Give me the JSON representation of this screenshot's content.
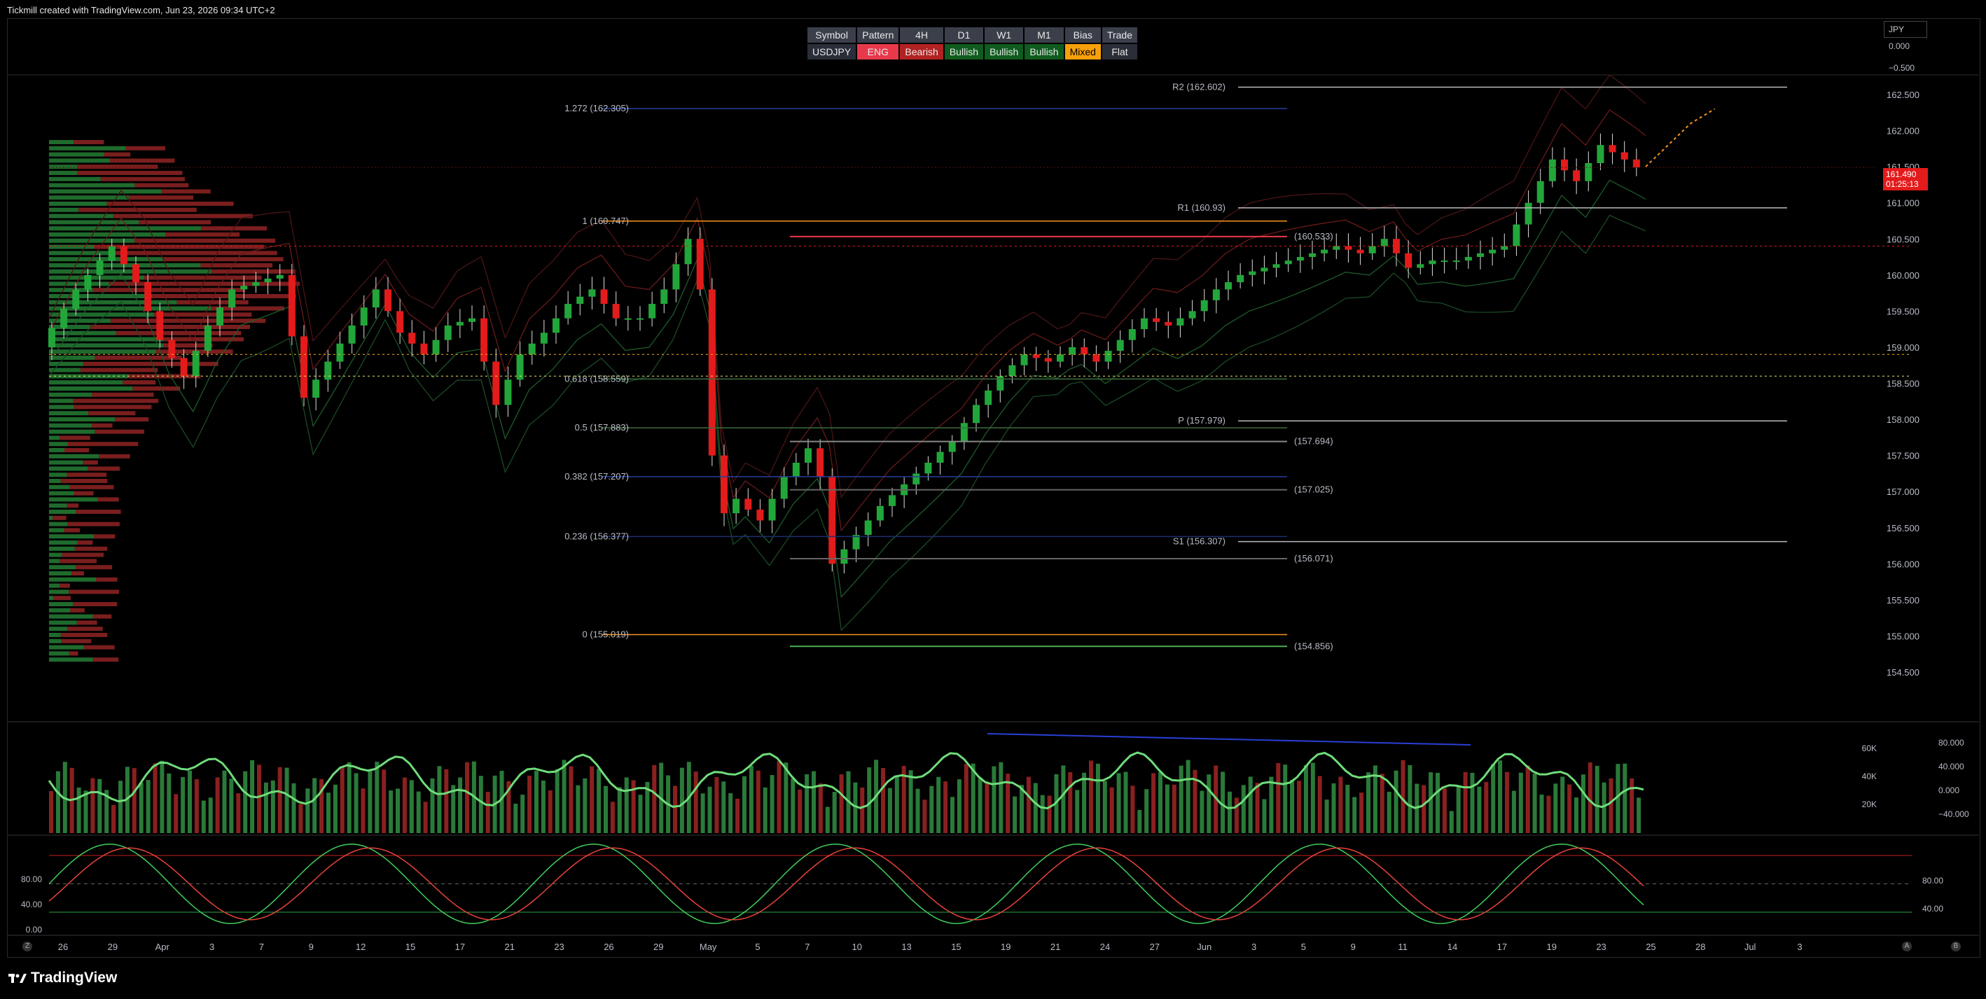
{
  "header": {
    "credit": "Tickmill created with TradingView.com, Jun 23, 2026 09:34 UTC+2"
  },
  "status_table": {
    "headers": [
      "Symbol",
      "Pattern",
      "4H",
      "D1",
      "W1",
      "M1",
      "Bias",
      "Trade"
    ],
    "values": [
      "USDJPY",
      "ENG",
      "Bearish",
      "Bullish",
      "Bullish",
      "Bullish",
      "Mixed",
      "Flat"
    ]
  },
  "currency_box": "JPY",
  "oscillator_top_labels": [
    "0.000",
    "−0.500"
  ],
  "price_badge": {
    "price": "161.490",
    "countdown": "01:25:13"
  },
  "price_axis": [
    "162.500",
    "162.000",
    "161.500",
    "161.000",
    "160.500",
    "160.000",
    "159.500",
    "159.000",
    "158.500",
    "158.000",
    "157.500",
    "157.000",
    "156.500",
    "156.000",
    "155.500",
    "155.000",
    "154.500"
  ],
  "levels": {
    "fib": [
      {
        "label": "1.272 (162.305)",
        "value": 162.305,
        "color": "#2a3f9e"
      },
      {
        "label": "1 (160.747)",
        "value": 160.747,
        "color": "#f7931e"
      },
      {
        "label": "0.618 (158.559)",
        "value": 158.559,
        "color": "#3d6e3d"
      },
      {
        "label": "0.5 (157.883)",
        "value": 157.883,
        "color": "#3d6e3d"
      },
      {
        "label": "0.382 (157.207)",
        "value": 157.207,
        "color": "#2a3f9e"
      },
      {
        "label": "0.236 (156.377)",
        "value": 156.377,
        "color": "#1e2e6e"
      },
      {
        "label": "0 (155.019)",
        "value": 155.019,
        "color": "#f7931e"
      }
    ],
    "pivots": [
      {
        "label": "R2 (162.602)",
        "value": 162.602
      },
      {
        "label": "R1 (160.93)",
        "value": 160.93
      },
      {
        "label": "P (157.979)",
        "value": 157.979
      },
      {
        "label": "S1 (156.307)",
        "value": 156.307
      }
    ],
    "zones": [
      {
        "label": "(160.533)",
        "value": 160.533,
        "color": "#e8394a"
      },
      {
        "label": "(157.694)",
        "value": 157.694,
        "color": "#888888"
      },
      {
        "label": "(157.025)",
        "value": 157.025,
        "color": "#666666"
      },
      {
        "label": "(156.071)",
        "value": 156.071,
        "color": "#666666"
      },
      {
        "label": "(154.856)",
        "value": 154.856,
        "color": "#4caf50"
      }
    ]
  },
  "volume_axis_left": [
    "60K",
    "40K",
    "20K"
  ],
  "volume_axis_right": [
    "80.000",
    "40.000",
    "0.000",
    "−40.000"
  ],
  "stoch_axis_left": [
    "80.00",
    "40.00",
    "0.00"
  ],
  "stoch_axis_right": [
    "80.00",
    "40.00"
  ],
  "time_axis": [
    "26",
    "29",
    "Apr",
    "3",
    "7",
    "9",
    "12",
    "15",
    "17",
    "21",
    "23",
    "26",
    "29",
    "May",
    "5",
    "7",
    "10",
    "13",
    "15",
    "19",
    "21",
    "24",
    "27",
    "Jun",
    "3",
    "5",
    "9",
    "11",
    "14",
    "17",
    "19",
    "23",
    "25",
    "28",
    "Jul",
    "3"
  ],
  "corner_buttons": [
    "Z",
    "A",
    "B"
  ],
  "footer": {
    "brand": "TradingView"
  },
  "chart_data": {
    "type": "candlestick",
    "symbol": "USDJPY",
    "ylim": [
      154.3,
      162.7
    ],
    "last_price": 161.49,
    "close_path": [
      [
        0,
        159.0
      ],
      [
        3,
        159.8
      ],
      [
        6,
        160.4
      ],
      [
        8,
        159.9
      ],
      [
        10,
        159.1
      ],
      [
        12,
        158.6
      ],
      [
        14,
        159.3
      ],
      [
        16,
        159.8
      ],
      [
        18,
        159.9
      ],
      [
        20,
        160.0
      ],
      [
        22,
        158.3
      ],
      [
        24,
        158.8
      ],
      [
        26,
        159.3
      ],
      [
        28,
        159.8
      ],
      [
        30,
        159.2
      ],
      [
        32,
        158.9
      ],
      [
        34,
        159.3
      ],
      [
        36,
        159.4
      ],
      [
        38,
        158.2
      ],
      [
        40,
        158.9
      ],
      [
        42,
        159.2
      ],
      [
        44,
        159.6
      ],
      [
        46,
        159.8
      ],
      [
        48,
        159.4
      ],
      [
        50,
        159.4
      ],
      [
        52,
        159.8
      ],
      [
        54,
        160.5
      ],
      [
        55,
        159.8
      ],
      [
        56,
        157.5
      ],
      [
        57,
        156.7
      ],
      [
        58,
        156.9
      ],
      [
        60,
        156.6
      ],
      [
        62,
        157.2
      ],
      [
        64,
        157.6
      ],
      [
        65,
        157.2
      ],
      [
        66,
        156.0
      ],
      [
        68,
        156.4
      ],
      [
        70,
        156.8
      ],
      [
        72,
        157.1
      ],
      [
        74,
        157.4
      ],
      [
        76,
        157.7
      ],
      [
        78,
        158.2
      ],
      [
        80,
        158.6
      ],
      [
        82,
        158.9
      ],
      [
        84,
        158.8
      ],
      [
        86,
        159.0
      ],
      [
        88,
        158.8
      ],
      [
        90,
        159.1
      ],
      [
        92,
        159.4
      ],
      [
        94,
        159.3
      ],
      [
        96,
        159.5
      ],
      [
        98,
        159.8
      ],
      [
        100,
        160.0
      ],
      [
        102,
        160.1
      ],
      [
        104,
        160.2
      ],
      [
        106,
        160.3
      ],
      [
        108,
        160.4
      ],
      [
        110,
        160.3
      ],
      [
        112,
        160.5
      ],
      [
        114,
        160.1
      ],
      [
        116,
        160.2
      ],
      [
        118,
        160.2
      ],
      [
        120,
        160.3
      ],
      [
        122,
        160.4
      ],
      [
        124,
        161.0
      ],
      [
        126,
        161.6
      ],
      [
        128,
        161.3
      ],
      [
        130,
        161.8
      ],
      [
        132,
        161.6
      ],
      [
        133,
        161.49
      ]
    ],
    "projection": [
      [
        133,
        161.5
      ],
      [
        135,
        162.1
      ],
      [
        137,
        162.3
      ]
    ],
    "volume_cvd": {
      "ylim_left": [
        0,
        60000
      ],
      "ylim_right": [
        -40,
        80
      ]
    },
    "stochastic": {
      "levels": [
        80,
        40
      ],
      "ylim": [
        0,
        100
      ]
    }
  }
}
